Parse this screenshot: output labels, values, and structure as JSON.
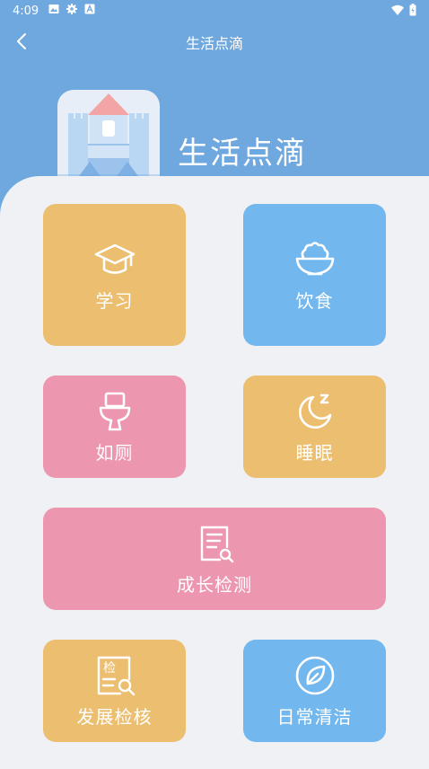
{
  "status_bar": {
    "time": "4:09"
  },
  "header": {
    "title": "生活点滴",
    "app_name": "生活点滴"
  },
  "colors": {
    "header_bg": "#6fa8de",
    "orange": "#ecbe70",
    "blue": "#72b7ee",
    "pink": "#ec96b0",
    "background": "#f0f1f5"
  },
  "tiles": [
    {
      "label": "学习",
      "icon": "graduation-cap-icon",
      "color": "orange"
    },
    {
      "label": "饮食",
      "icon": "rice-bowl-icon",
      "color": "blue"
    },
    {
      "label": "如厕",
      "icon": "toilet-icon",
      "color": "pink"
    },
    {
      "label": "睡眠",
      "icon": "moon-sleep-icon",
      "color": "orange"
    },
    {
      "label": "成长检测",
      "icon": "document-search-icon",
      "color": "pink"
    },
    {
      "label": "发展检核",
      "icon": "check-document-icon",
      "color": "orange",
      "icon_text": "检"
    },
    {
      "label": "日常清洁",
      "icon": "leaf-icon",
      "color": "blue"
    }
  ]
}
